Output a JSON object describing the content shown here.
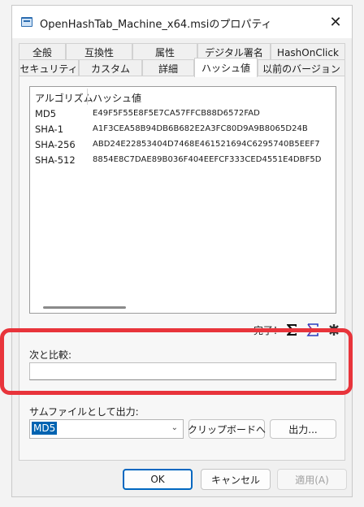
{
  "window": {
    "title": "OpenHashTab_Machine_x64.msiのプロパティ",
    "close_glyph": "✕"
  },
  "tabs_row1": [
    "全般",
    "互換性",
    "属性",
    "デジタル署名",
    "HashOnClick"
  ],
  "tabs_row2": [
    "セキュリティ",
    "カスタム",
    "詳細",
    "ハッシュ値",
    "以前のバージョン"
  ],
  "active_tab": "ハッシュ値",
  "list": {
    "col_algo": "アルゴリズム",
    "col_hash": "ハッシュ値",
    "rows": [
      {
        "algo": "MD5",
        "hash": "E49F5F55E8F5E7CA57FFCB88D6572FAD"
      },
      {
        "algo": "SHA-1",
        "hash": "A1F3CEA58B94DB6B682E2A3FC80D9A9B8065D24B"
      },
      {
        "algo": "SHA-256",
        "hash": "ABD24E22853404D7468E461521694C6295740B5EEF7"
      },
      {
        "algo": "SHA-512",
        "hash": "8854E8C7DAE89B036F404EEFCF333CED4551E4DBF5D"
      }
    ]
  },
  "status": {
    "text": "完了！",
    "icons": [
      "sigma-icon",
      "sigma-outline-icon",
      "gear-icon"
    ]
  },
  "compare": {
    "label": "次と比較:",
    "value": ""
  },
  "export": {
    "label": "サムファイルとして出力:",
    "select_value": "MD5",
    "clipboard_button": "クリップボードへ",
    "output_button": "出力..."
  },
  "footer": {
    "ok": "OK",
    "cancel": "キャンセル",
    "apply": "適用(A)"
  },
  "colors": {
    "highlight": "#e8343b",
    "accent": "#0067c0",
    "selection": "#0063b1"
  }
}
